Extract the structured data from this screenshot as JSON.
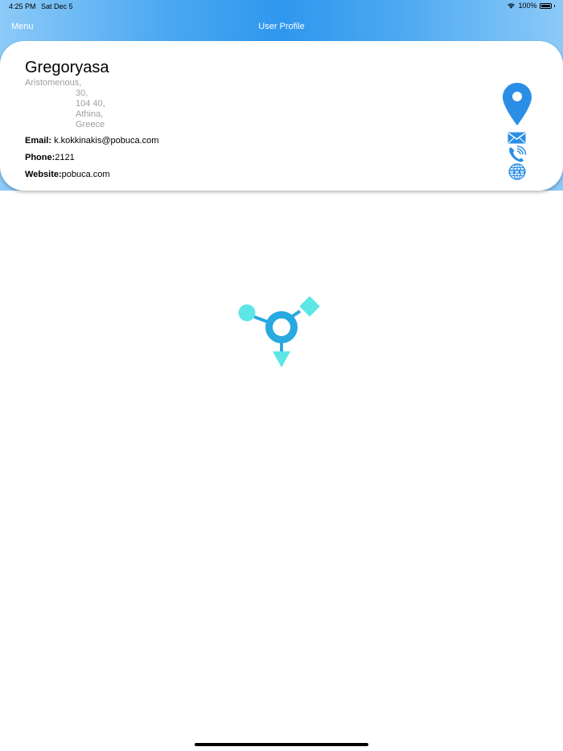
{
  "status_bar": {
    "time": "4:25 PM",
    "date": "Sat Dec 5",
    "battery": "100%",
    "wifi_icon": "wifi-icon",
    "battery_icon": "battery-icon"
  },
  "nav": {
    "menu_label": "Menu",
    "title": "User Profile"
  },
  "profile": {
    "name": "Gregoryasa",
    "address": {
      "street": "Aristomenous,",
      "number": "30,",
      "postal_code": "104 40,",
      "city": "Athina,",
      "country": "Greece"
    },
    "email_label": "Email:",
    "email": " k.kokkinakis@pobuca.com",
    "phone_label": "Phone:",
    "phone": "2121",
    "website_label": "Website:",
    "website": "pobuca.com"
  },
  "icons": {
    "location": "location-pin-icon",
    "mail": "mail-icon",
    "phone": "phone-icon",
    "web": "globe-www-icon",
    "loading": "loading-spinner-icon"
  },
  "colors": {
    "accent": "#2f97ee",
    "icon_blue": "#2b8ee6",
    "loader_teal": "#5ce6e6",
    "loader_blue": "#28a9e0",
    "address_gray": "#9e9e9e"
  }
}
